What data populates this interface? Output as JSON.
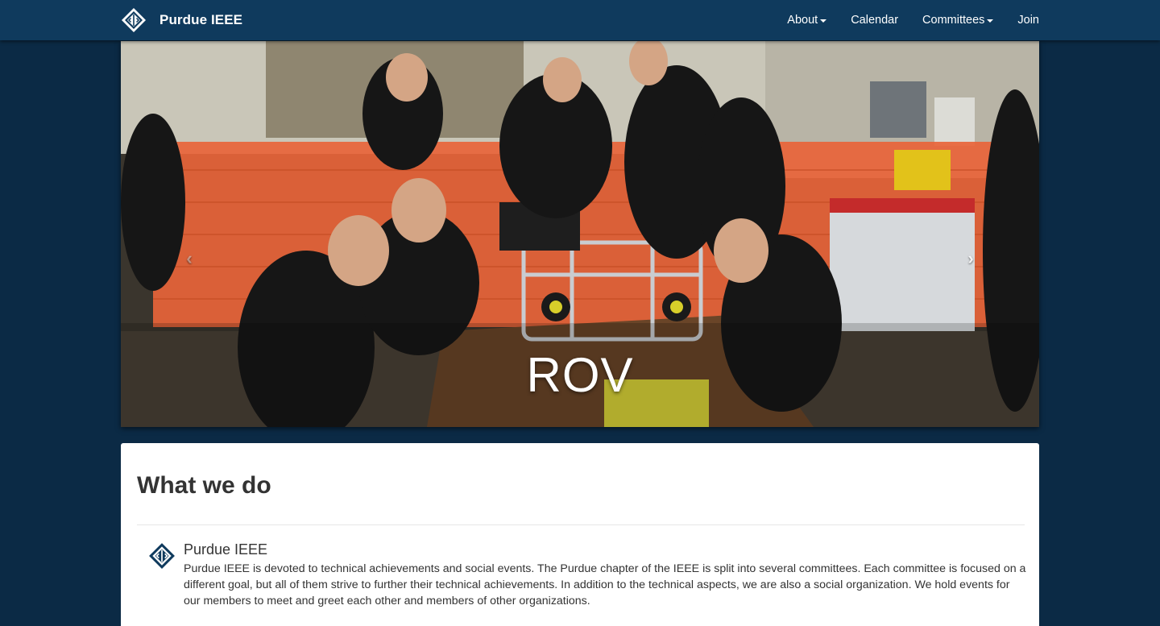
{
  "navbar": {
    "brand": "Purdue IEEE",
    "links": [
      {
        "label": "About",
        "dropdown": true
      },
      {
        "label": "Calendar",
        "dropdown": false
      },
      {
        "label": "Committees",
        "dropdown": true
      },
      {
        "label": "Join",
        "dropdown": false
      }
    ]
  },
  "carousel": {
    "caption": "ROV",
    "prev_glyph": "‹",
    "next_glyph": "›"
  },
  "section": {
    "title": "What we do",
    "item": {
      "heading": "Purdue IEEE",
      "body": "Purdue IEEE is devoted to technical achievements and social events. The Purdue chapter of the IEEE is split into several committees. Each committee is focused on a different goal, but all of them strive to further their technical achievements. In addition to the technical aspects, we are also a social organization. We hold events for our members to meet and greet each other and members of other organizations."
    }
  },
  "colors": {
    "page_background": "#0b2a45",
    "navbar_background": "#0f3a5d",
    "panel_background": "#ffffff",
    "text": "#333333",
    "photo_orange_fence": "#e8643a"
  },
  "icons": {
    "brand_logo": "ieee-diamond-logo-icon",
    "item_logo": "ieee-diamond-logo-icon",
    "dropdown": "caret-down-icon",
    "carousel_prev": "chevron-left-icon",
    "carousel_next": "chevron-right-icon"
  }
}
